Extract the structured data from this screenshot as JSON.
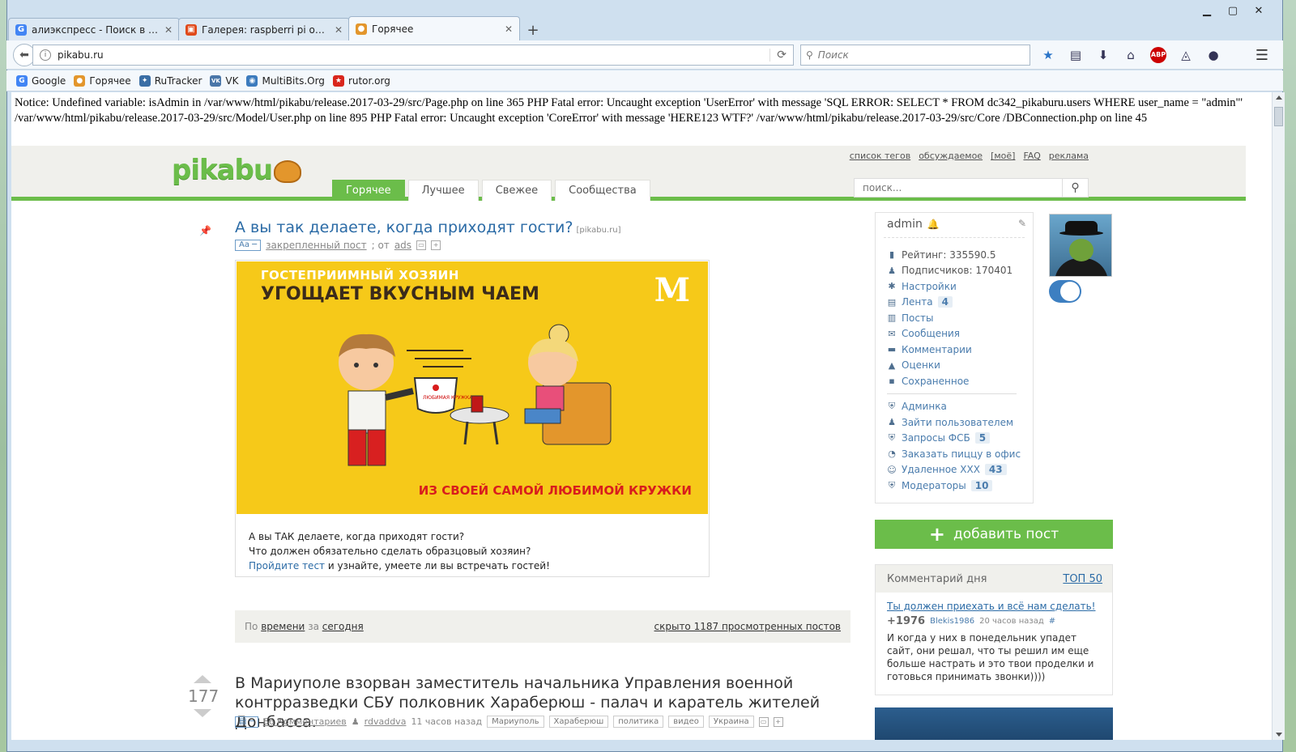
{
  "browser": {
    "tabs": [
      {
        "title": "алиэкспресс - Поиск в Go...",
        "icon": "google-icon",
        "color": "#4285f4",
        "glyph": "G"
      },
      {
        "title": "Галерея: raspberri pi опто...",
        "icon": "gallery-icon",
        "color": "#e04a1b",
        "glyph": "▣"
      },
      {
        "title": "Горячее",
        "icon": "pikabu-icon",
        "color": "#e3962c",
        "glyph": "●"
      }
    ],
    "new_tab": "+",
    "url": "pikabu.ru",
    "search_placeholder": "Поиск",
    "abp": "ABP",
    "bookmarks": [
      {
        "label": "Google",
        "color": "#4285f4",
        "glyph": "G"
      },
      {
        "label": "Горячее",
        "color": "#e3962c",
        "glyph": "●"
      },
      {
        "label": "RuTracker",
        "color": "#3a6ea5",
        "glyph": "✦"
      },
      {
        "label": "VK",
        "color": "#4a76a8",
        "glyph": "VK"
      },
      {
        "label": "MultiBits.Org",
        "color": "#3c7bbd",
        "glyph": "◉"
      },
      {
        "label": "rutor.org",
        "color": "#d9261c",
        "glyph": "★"
      }
    ]
  },
  "error_text": "Notice: Undefined variable: isAdmin in /var/www/html/pikabu/release.2017-03-29/src/Page.php on line 365 PHP Fatal error: Uncaught exception 'UserError' with message 'SQL ERROR: SELECT * FROM dc342_pikaburu.users WHERE user_name = \"admin\"' /var/www/html/pikabu/release.2017-03-29/src/Model/User.php on line 895 PHP Fatal error: Uncaught exception 'CoreError' with message 'HERE123 WTF?' /var/www/html/pikabu/release.2017-03-29/src/Core /DBConnection.php on line 45",
  "site": {
    "logo": "pikabu",
    "top_links": [
      "список тегов",
      "обсуждаемое",
      "[моё]",
      "FAQ",
      "реклама"
    ],
    "nav_tabs": [
      "Горячее",
      "Лучшее",
      "Свежее",
      "Сообщества"
    ],
    "search_placeholder": "поиск..."
  },
  "post1": {
    "title": "А вы так делаете, когда приходят гости?",
    "source": "[pikabu.ru]",
    "font_btn": "Аа ─",
    "pinned": "закрепленный пост",
    "from": "; от",
    "author": "ads",
    "ad_line1": "ГОСТЕПРИИМНЫЙ ХОЗЯИН",
    "ad_line2": "УГОЩАЕТ ВКУСНЫМ ЧАЕМ",
    "ad_line3": "ИЗ СВОЕЙ САМОЙ ЛЮБИМОЙ КРУЖКИ",
    "ad_mug": "ЛЮБИМАЯ КРУЖКА",
    "text1": "А вы ТАК делаете, когда приходят гости?",
    "text2": "Что должен обязательно сделать образцовый хозяин?",
    "link": "Пройдите тест",
    "text3": " и узнайте, умеете ли вы встречать гостей!"
  },
  "filter": {
    "by": "По",
    "sort": "времени",
    "for": "за",
    "period": "сегодня",
    "hidden": "скрыто 1187 просмотренных постов"
  },
  "post2": {
    "votes": "177",
    "title": "В Мариуполе взорван заместитель начальника Управления военной контрразведки СБУ полковник Хараберюш - палач и каратель жителей Донбасса.",
    "comments": "66 Комментариев",
    "author": "rdvaddva",
    "time": "11 часов назад",
    "tags": [
      "Мариуполь",
      "Хараберюш",
      "политика",
      "видео",
      "Украина"
    ]
  },
  "user": {
    "name": "admin",
    "rating": "Рейтинг: 335590.5",
    "subscribers": "Подписчиков: 170401",
    "menu": [
      {
        "label": "Настройки",
        "icon": "gear-icon",
        "glyph": "✱"
      },
      {
        "label": "Лента",
        "icon": "feed-icon",
        "glyph": "▤",
        "badge": "4"
      },
      {
        "label": "Посты",
        "icon": "posts-icon",
        "glyph": "▥"
      },
      {
        "label": "Сообщения",
        "icon": "mail-icon",
        "glyph": "✉"
      },
      {
        "label": "Комментарии",
        "icon": "comment-icon",
        "glyph": "▬"
      },
      {
        "label": "Оценки",
        "icon": "rating-icon",
        "glyph": "▲"
      },
      {
        "label": "Сохраненное",
        "icon": "save-icon",
        "glyph": "▪"
      }
    ],
    "admin_menu": [
      {
        "label": "Админка",
        "icon": "shield-icon",
        "glyph": "⛨"
      },
      {
        "label": "Зайти пользователем",
        "icon": "user-switch-icon",
        "glyph": "♟"
      },
      {
        "label": "Запросы ФСБ",
        "icon": "shield-icon",
        "glyph": "⛨",
        "badge": "5"
      },
      {
        "label": "Заказать пиццу в офис",
        "icon": "pizza-icon",
        "glyph": "◔"
      },
      {
        "label": "Удаленное XXX",
        "icon": "face-icon",
        "glyph": "☺",
        "badge": "43"
      },
      {
        "label": "Модераторы",
        "icon": "shield-icon",
        "glyph": "⛨",
        "badge": "10"
      }
    ]
  },
  "add_post": "добавить пост",
  "comment_of_day": {
    "title": "Комментарий дня",
    "top": "ТОП 50",
    "link": "Ты должен приехать и всё нам сделать!",
    "score": "+1976",
    "author": "Blekis1986",
    "time": "20 часов назад",
    "hash": "#",
    "body": "И когда у них в понедельник упадет сайт, они решал, что ты решил им еще больше настрать и это твои проделки и готовься принимать звонки))))"
  }
}
